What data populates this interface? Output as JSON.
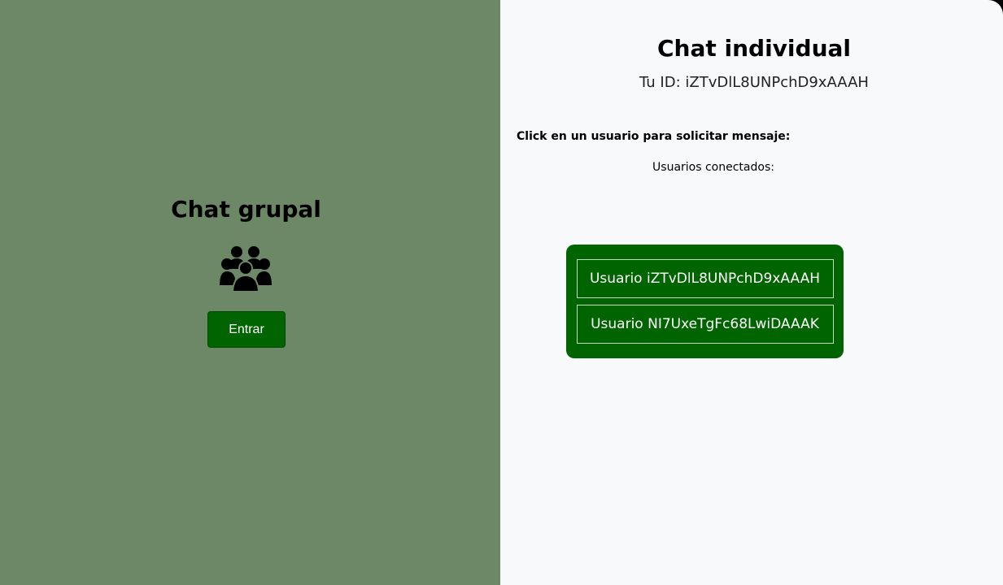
{
  "group_chat": {
    "title": "Chat grupal",
    "icon": "users-group-icon",
    "enter_label": "Entrar"
  },
  "individual_chat": {
    "title": "Chat individual",
    "my_id": "Tu ID: iZTvDlL8UNPchD9xAAAH",
    "instruction": "Click en un usuario para solicitar mensaje:",
    "connected_label": "Usuarios conectados:",
    "users": [
      {
        "label": "Usuario iZTvDlL8UNPchD9xAAAH"
      },
      {
        "label": "Usuario NI7UxeTgFc68LwiDAAAK"
      }
    ]
  },
  "colors": {
    "left_panel_bg": "#6d8866",
    "right_panel_bg": "#f8f9fa",
    "accent_green": "#006400"
  }
}
